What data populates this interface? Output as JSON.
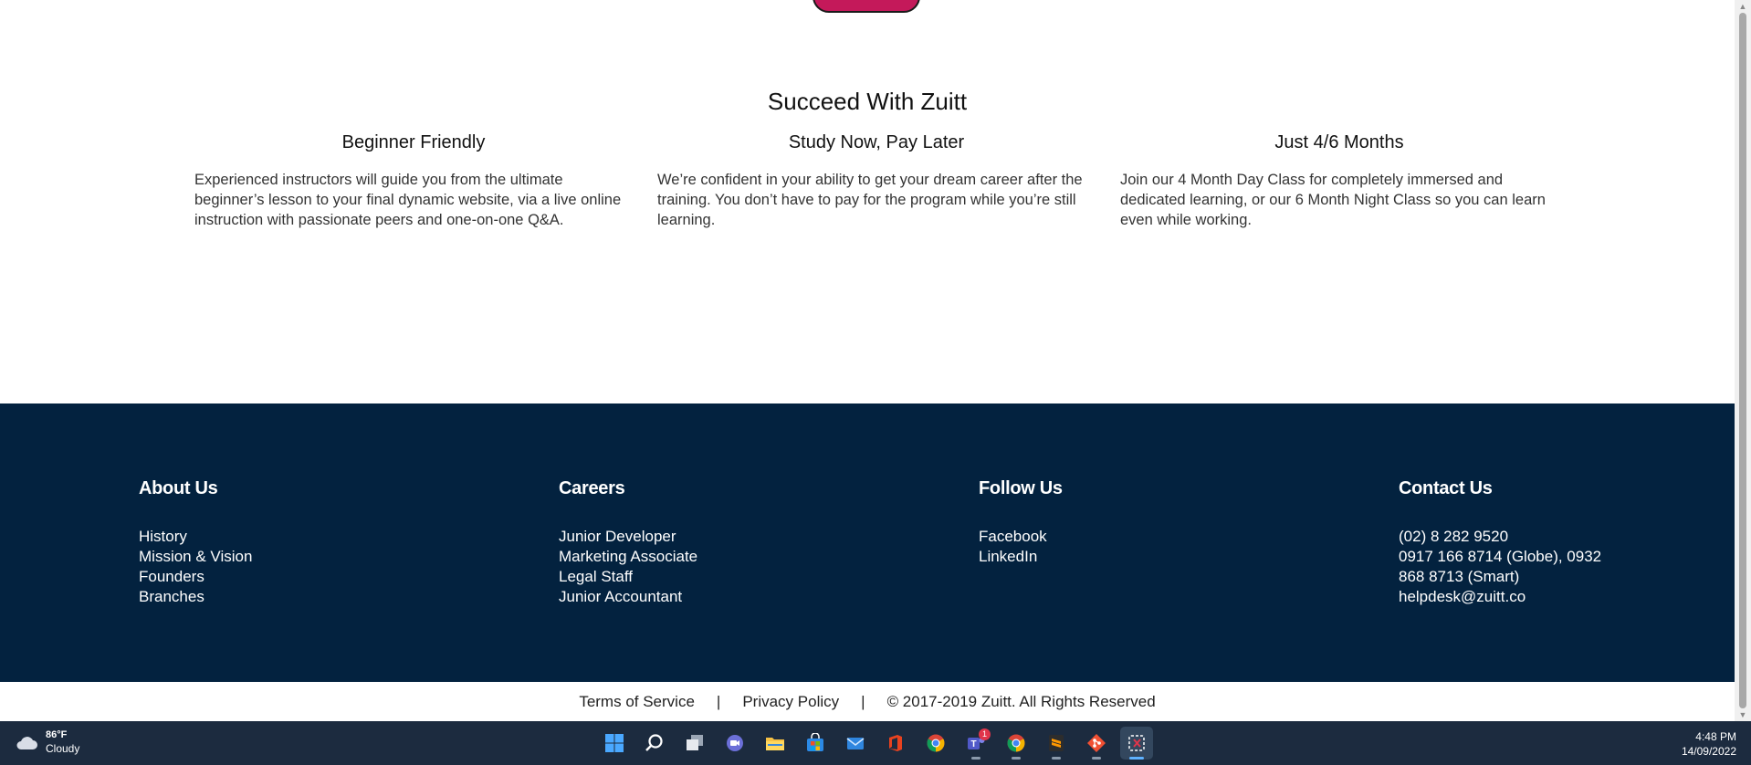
{
  "section": {
    "title": "Succeed With Zuitt",
    "features": [
      {
        "title": "Beginner Friendly",
        "text": "Experienced instructors will guide you from the ultimate beginner’s lesson to your final dynamic website, via a live online instruction with passionate peers and one-on-one Q&A."
      },
      {
        "title": "Study Now, Pay Later",
        "text": "We’re confident in your ability to get your dream career after the training. You don’t have to pay for the program while you’re still learning."
      },
      {
        "title": "Just 4/6 Months",
        "text": "Join our 4 Month Day Class for completely immersed and dedicated learning, or our 6 Month Night Class so you can learn even while working."
      }
    ]
  },
  "footer": {
    "columns": [
      {
        "title": "About Us",
        "items": [
          "History",
          "Mission & Vision",
          "Founders",
          "Branches"
        ]
      },
      {
        "title": "Careers",
        "items": [
          "Junior Developer",
          "Marketing Associate",
          "Legal Staff",
          "Junior Accountant"
        ]
      },
      {
        "title": "Follow Us",
        "items": [
          "Facebook",
          "LinkedIn"
        ]
      },
      {
        "title": "Contact Us",
        "items": [
          "(02) 8 282 9520",
          "0917 166 8714 (Globe), 0932 868 8713 (Smart)",
          "helpdesk@zuitt.co"
        ]
      }
    ],
    "background": "#03223f"
  },
  "legal": {
    "terms": "Terms of Service",
    "separator": "|",
    "privacy": "Privacy Policy",
    "copyright": "© 2017-2019 Zuitt. All Rights Reserved"
  },
  "colors": {
    "accent": "#c4195a",
    "footer": "#03223f",
    "taskbar": "#1c2b3f"
  },
  "taskbar": {
    "weather": {
      "temp": "86°F",
      "condition": "Cloudy"
    },
    "time": "4:48 PM",
    "date": "14/09/2022",
    "teams_badge": "1",
    "icons": [
      "windows-start-icon",
      "search-icon",
      "task-view-icon",
      "chat-icon",
      "file-explorer-icon",
      "microsoft-store-icon",
      "mail-icon",
      "office-icon",
      "chrome-icon",
      "teams-icon",
      "chrome-icon",
      "sublime-text-icon",
      "git-icon",
      "snipping-tool-icon"
    ]
  }
}
